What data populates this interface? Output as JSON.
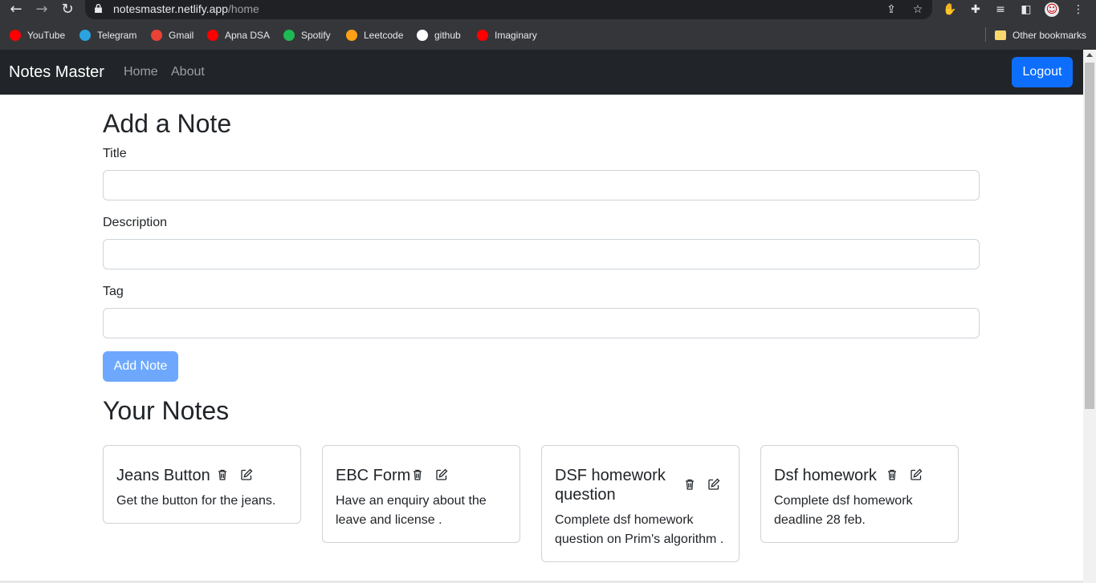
{
  "browser": {
    "url_host": "notesmaster.netlify.app",
    "url_path": "/home",
    "bookmarks": [
      {
        "label": "YouTube",
        "color": "#ff0000"
      },
      {
        "label": "Telegram",
        "color": "#2aa3df"
      },
      {
        "label": "Gmail",
        "color": "#ea4335"
      },
      {
        "label": "Apna DSA",
        "color": "#ff0000"
      },
      {
        "label": "Spotify",
        "color": "#1db954"
      },
      {
        "label": "Leetcode",
        "color": "#ffa116"
      },
      {
        "label": "github",
        "color": "#ffffff"
      },
      {
        "label": "Imaginary",
        "color": "#ff0000"
      }
    ],
    "other_bookmarks": "Other bookmarks"
  },
  "navbar": {
    "brand": "Notes Master",
    "links": [
      "Home",
      "About"
    ],
    "logout": "Logout"
  },
  "form": {
    "heading": "Add a Note",
    "title_label": "Title",
    "description_label": "Description",
    "tag_label": "Tag",
    "submit": "Add Note"
  },
  "notes": {
    "heading": "Your Notes",
    "items": [
      {
        "title": "Jeans Button",
        "description": "Get the button for the jeans."
      },
      {
        "title_lines": [
          "DSF homework",
          "question"
        ],
        "title": "EBC Form",
        "description_lines": [
          "Have an enquiry about the",
          "leave and license ."
        ]
      },
      {
        "title_lines": [
          "DSF homework",
          "question"
        ],
        "description_lines": [
          "Complete dsf homework",
          "question on Prim's algorithm ."
        ]
      },
      {
        "title": "Dsf homework",
        "description_lines": [
          "Complete dsf homework",
          "deadline 28 feb."
        ]
      }
    ]
  },
  "colors": {
    "primary": "#0d6efd",
    "primary_disabled": "#6ea8fe",
    "navbar": "#212529"
  }
}
